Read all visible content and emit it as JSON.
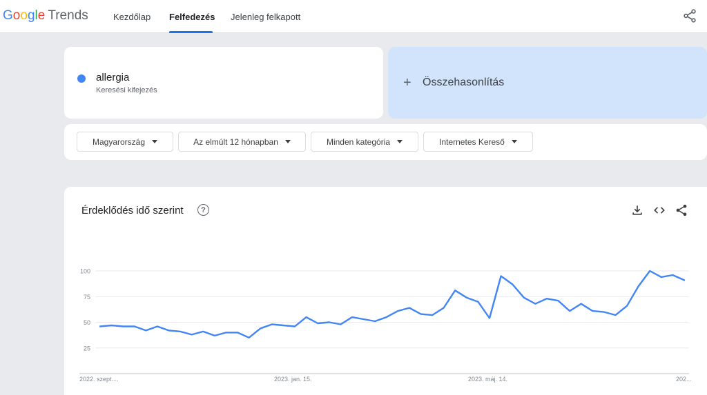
{
  "header": {
    "logo_letters": [
      "G",
      "o",
      "o",
      "g",
      "l",
      "e"
    ],
    "logo_suffix": "Trends",
    "tabs": [
      {
        "label": "Kezdőlap",
        "active": false
      },
      {
        "label": "Felfedezés",
        "active": true
      },
      {
        "label": "Jelenleg felkapott",
        "active": false
      }
    ],
    "share_icon": "share-icon"
  },
  "search": {
    "term": "allergia",
    "term_type": "Keresési kifejezés",
    "term_color": "#4285f4",
    "compare_icon": "plus-icon",
    "compare_label": "Összehasonlítás"
  },
  "filters": [
    {
      "label": "Magyarország"
    },
    {
      "label": "Az elmúlt 12 hónapban"
    },
    {
      "label": "Minden kategória"
    },
    {
      "label": "Internetes Kereső"
    }
  ],
  "interest": {
    "title": "Érdeklődés idő szerint",
    "help_icon": "help-icon",
    "tools": [
      "download-icon",
      "embed-code-icon",
      "share-icon"
    ]
  },
  "chart_data": {
    "type": "line",
    "x_tick_labels": [
      "2022. szept....",
      "2023. jan. 15.",
      "2023. máj. 14.",
      "202..."
    ],
    "y_ticks": [
      25,
      50,
      75,
      100
    ],
    "ylim": [
      0,
      100
    ],
    "grid": true,
    "series": [
      {
        "color": "#4285f4",
        "values": [
          46,
          47,
          46,
          46,
          42,
          46,
          42,
          41,
          38,
          41,
          37,
          40,
          40,
          35,
          44,
          48,
          47,
          46,
          55,
          49,
          50,
          48,
          55,
          53,
          51,
          55,
          61,
          64,
          58,
          57,
          64,
          81,
          74,
          70,
          54,
          95,
          87,
          74,
          68,
          73,
          71,
          61,
          68,
          61,
          60,
          57,
          66,
          85,
          100,
          94,
          96,
          91
        ]
      }
    ]
  }
}
